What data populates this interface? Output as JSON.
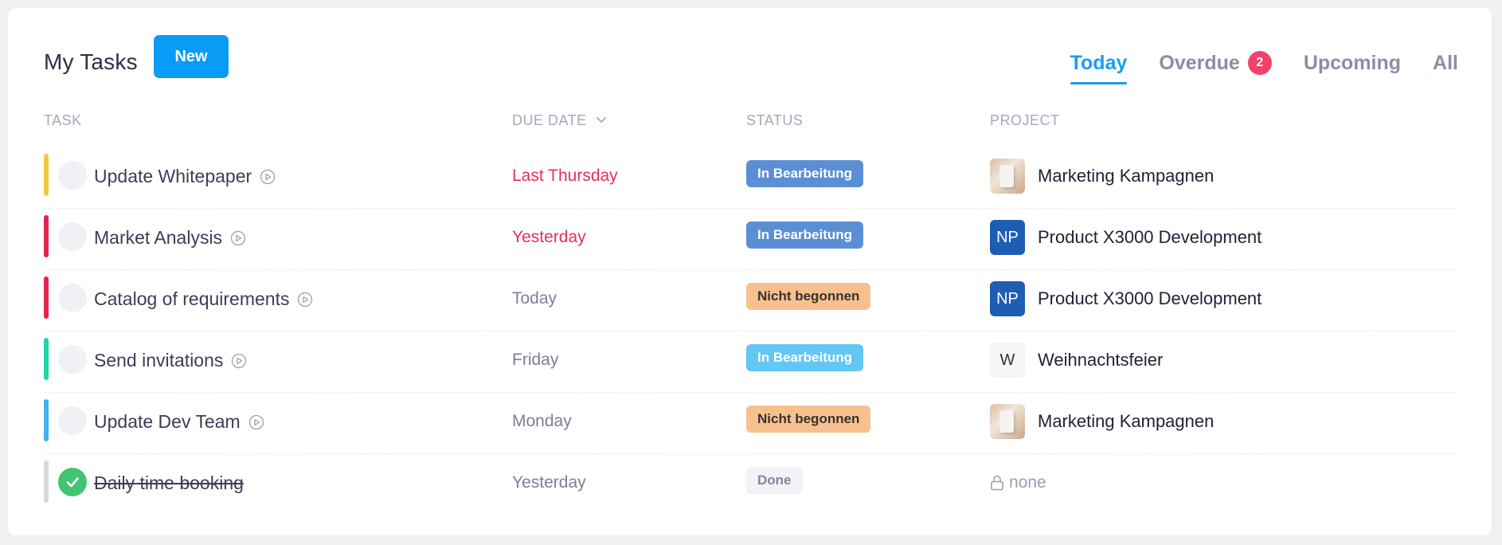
{
  "header": {
    "title": "My Tasks",
    "new_label": "New"
  },
  "tabs": [
    {
      "label": "Today",
      "active": true
    },
    {
      "label": "Overdue",
      "badge": "2"
    },
    {
      "label": "Upcoming"
    },
    {
      "label": "All"
    }
  ],
  "columns": {
    "task": "TASK",
    "due": "DUE DATE",
    "status": "STATUS",
    "project": "PROJECT"
  },
  "colors": {
    "accent": "#089cf7",
    "overdue": "#e8305a"
  },
  "tasks": [
    {
      "name": "Update Whitepaper",
      "due": "Last Thursday",
      "status": "In Bearbeitung",
      "project": "Marketing Kampagnen",
      "avatar": "",
      "priority_color": "#f1cc3a"
    },
    {
      "name": "Market Analysis",
      "due": "Yesterday",
      "status": "In Bearbeitung",
      "project": "Product X3000 Development",
      "avatar": "NP",
      "priority_color": "#e52450"
    },
    {
      "name": "Catalog of requirements",
      "due": "Today",
      "status": "Nicht begonnen",
      "project": "Product X3000 Development",
      "avatar": "NP",
      "priority_color": "#e52450"
    },
    {
      "name": "Send invitations",
      "due": "Friday",
      "status": "In Bearbeitung",
      "project": "Weihnachtsfeier",
      "avatar": "W",
      "priority_color": "#1fd7a5"
    },
    {
      "name": "Update Dev Team",
      "due": "Monday",
      "status": "Nicht begonnen",
      "project": "Marketing Kampagnen",
      "avatar": "",
      "priority_color": "#3fb2f1"
    },
    {
      "name": "Daily time booking",
      "due": "Yesterday",
      "status": "Done",
      "project": "none",
      "avatar": "",
      "priority_color": "#d9d9dc"
    }
  ]
}
